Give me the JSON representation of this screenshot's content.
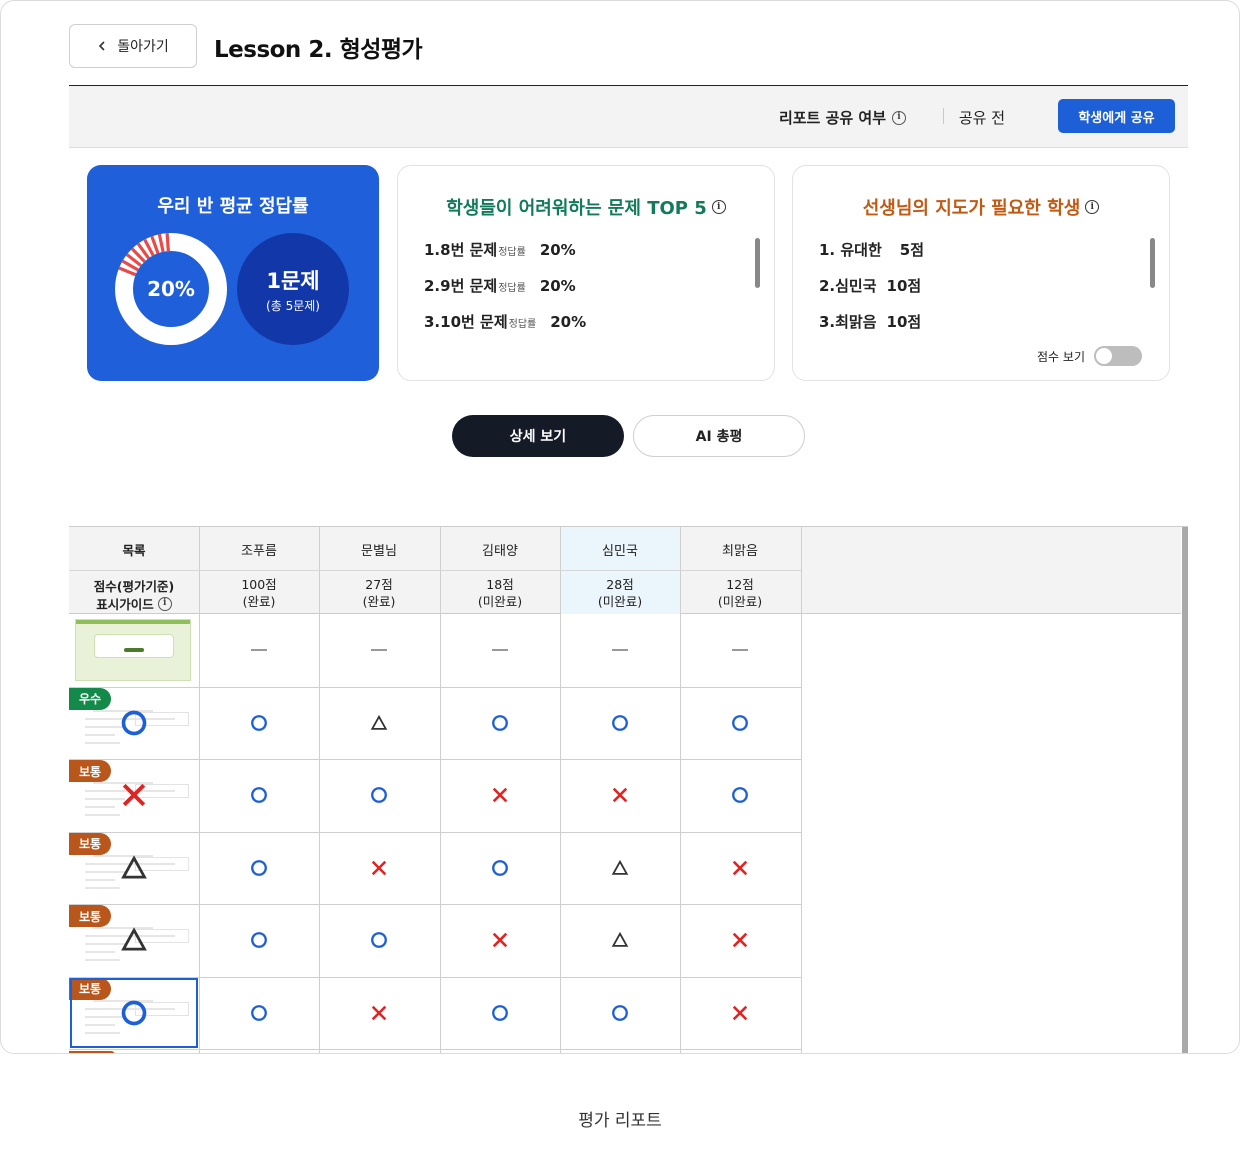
{
  "header": {
    "back_label": "돌아가기",
    "title": "Lesson 2. 형성평가"
  },
  "share": {
    "label": "리포트 공유 여부",
    "status": "공유 전",
    "button_label": "학생에게 공유"
  },
  "avg_card": {
    "title": "우리 반 평균 정답률",
    "percent_label": "20%",
    "percent_value": 20,
    "count_label": "1문제",
    "total_label": "(총 5문제)"
  },
  "top5_card": {
    "title": "학생들이 어려워하는 문제 TOP 5",
    "items": [
      {
        "name": "1.8번 문제",
        "sub": "정답률",
        "value": "20%"
      },
      {
        "name": "2.9번 문제",
        "sub": "정답률",
        "value": "20%"
      },
      {
        "name": "3.10번 문제",
        "sub": "정답률",
        "value": "20%"
      }
    ]
  },
  "guide_card": {
    "title": "선생님의 지도가 필요한 학생",
    "items": [
      {
        "name": "1. 유대한",
        "score": "5점"
      },
      {
        "name": "2.심민국",
        "score": "10점"
      },
      {
        "name": "3.최맑음",
        "score": "10점"
      }
    ],
    "toggle_label": "점수 보기",
    "toggle_on": false
  },
  "tabs": {
    "detail": "상세 보기",
    "ai": "AI 총평"
  },
  "grid": {
    "col_label": "목록",
    "score_label": "점수(평가기준)",
    "guide_label": "표시가이드",
    "students": [
      {
        "name": "조푸름",
        "score": "100점",
        "status": "(완료)"
      },
      {
        "name": "문별님",
        "score": "27점",
        "status": "(완료)"
      },
      {
        "name": "김태양",
        "score": "18점",
        "status": "(미완료)"
      },
      {
        "name": "심민국",
        "score": "28점",
        "status": "(미완료)"
      },
      {
        "name": "최맑음",
        "score": "12점",
        "status": "(미완료)"
      }
    ],
    "rows": [
      {
        "badge": "",
        "answer": "",
        "marks": [
          "dash",
          "dash",
          "dash",
          "dash",
          "dash"
        ]
      },
      {
        "badge": "우수",
        "answer": "circle",
        "marks": [
          "circle",
          "triangle",
          "circle",
          "circle",
          "circle"
        ]
      },
      {
        "badge": "보통",
        "answer": "cross",
        "marks": [
          "circle",
          "circle",
          "cross",
          "cross",
          "circle"
        ]
      },
      {
        "badge": "보통",
        "answer": "triangle",
        "marks": [
          "circle",
          "cross",
          "circle",
          "triangle",
          "cross"
        ]
      },
      {
        "badge": "보통",
        "answer": "triangle",
        "marks": [
          "circle",
          "circle",
          "cross",
          "triangle",
          "cross"
        ]
      },
      {
        "badge": "보통",
        "answer": "circle",
        "marks": [
          "circle",
          "cross",
          "circle",
          "circle",
          "cross"
        ]
      }
    ]
  },
  "colors": {
    "primary": "#1f5fd9",
    "circle": "#1d5fd6",
    "cross": "#e02424",
    "triangle": "#333333",
    "good": "#138a4a",
    "normal": "#b8561b"
  },
  "caption": "평가 리포트"
}
